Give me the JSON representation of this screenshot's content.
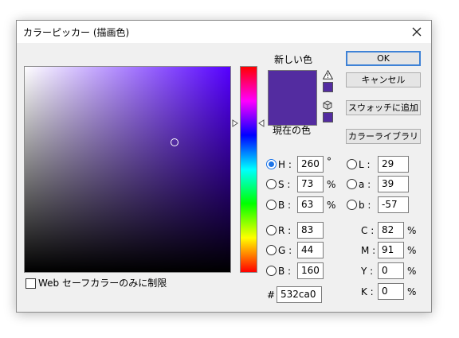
{
  "window": {
    "title": "カラーピッカー (描画色)"
  },
  "colors": {
    "current": "#532ca0",
    "previous": "#532ca0"
  },
  "preview": {
    "new_label": "新しい色",
    "current_label": "現在の色"
  },
  "icons": {
    "close": "close-icon",
    "gamut_warning": "warning-triangle-icon",
    "web_color": "cube-icon"
  },
  "buttons": {
    "ok": "OK",
    "cancel": "キャンセル",
    "add_swatch": "スウォッチに追加",
    "color_library": "カラーライブラリ"
  },
  "hsb": [
    {
      "label": "H :",
      "value": "260",
      "unit": "°",
      "selected": true
    },
    {
      "label": "S :",
      "value": "73",
      "unit": "%",
      "selected": false
    },
    {
      "label": "B :",
      "value": "63",
      "unit": "%",
      "selected": false
    }
  ],
  "rgb": [
    {
      "label": "R :",
      "value": "83"
    },
    {
      "label": "G :",
      "value": "44"
    },
    {
      "label": "B :",
      "value": "160"
    }
  ],
  "lab": [
    {
      "label": "L :",
      "value": "29"
    },
    {
      "label": "a :",
      "value": "39"
    },
    {
      "label": "b :",
      "value": "-57"
    }
  ],
  "cmyk": [
    {
      "label": "C :",
      "value": "82",
      "unit": "%"
    },
    {
      "label": "M :",
      "value": "91",
      "unit": "%"
    },
    {
      "label": "Y :",
      "value": "0",
      "unit": "%"
    },
    {
      "label": "K :",
      "value": "0",
      "unit": "%"
    }
  ],
  "hex": {
    "label": "#",
    "value": "532ca0"
  },
  "web_only": {
    "label": "Web セーフカラーのみに制限",
    "checked": false
  },
  "picker": {
    "hue": 260,
    "saturation": 73,
    "brightness": 63
  }
}
